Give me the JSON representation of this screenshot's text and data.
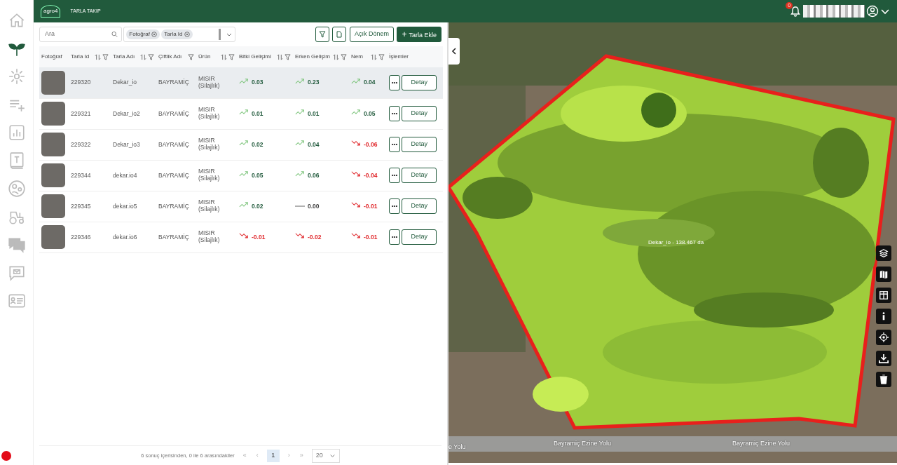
{
  "header": {
    "logo_text": "agro4",
    "app_title": "TARLA TAKIP",
    "notification_count": "0"
  },
  "sidebar": {
    "items": [
      {
        "kind": "home",
        "selected": false
      },
      {
        "kind": "leaf",
        "selected": true
      },
      {
        "kind": "sensor",
        "selected": false
      },
      {
        "kind": "list-add",
        "selected": false
      },
      {
        "kind": "chart",
        "selected": false
      },
      {
        "kind": "book",
        "selected": false
      },
      {
        "kind": "face",
        "selected": false
      },
      {
        "kind": "tractor",
        "selected": false
      },
      {
        "kind": "chat",
        "selected": false
      },
      {
        "kind": "mail",
        "selected": false
      },
      {
        "kind": "card",
        "selected": false
      }
    ]
  },
  "toolbar": {
    "search": {
      "placeholder": "Ara"
    },
    "column_chips": [
      "Fotoğraf",
      "Tarla Id"
    ],
    "open_period_button": "Açık Dönem",
    "add_button": {
      "icon": "+",
      "label": "Tarla Ekle"
    }
  },
  "table": {
    "columns": [
      {
        "label": "Fotoğraf",
        "sortable": false,
        "filterable": false
      },
      {
        "label": "Tarla Id",
        "sortable": true,
        "filterable": true
      },
      {
        "label": "Tarla Adı",
        "sortable": true,
        "filterable": true
      },
      {
        "label": "Çiftlik Adı",
        "sortable": false,
        "filterable": true
      },
      {
        "label": "Ürün",
        "sortable": true,
        "filterable": true
      },
      {
        "label": "Bitki Gelişimi",
        "sortable": true,
        "filterable": true
      },
      {
        "label": "Erken Gelişim",
        "sortable": true,
        "filterable": true
      },
      {
        "label": "Nem",
        "sortable": true,
        "filterable": true
      },
      {
        "label": "İşlemler",
        "sortable": false,
        "filterable": false
      }
    ],
    "rows": [
      {
        "selected": true,
        "id": "229320",
        "name": "Dekar_io",
        "farm": "BAYRAMİÇ",
        "crop": "MISIR",
        "crop_type": "(Silajlık)",
        "metrics": [
          {
            "kind": "up",
            "value": "0.03"
          },
          {
            "kind": "up",
            "value": "0.23"
          },
          {
            "kind": "up",
            "value": "0.04"
          }
        ],
        "more": "•••",
        "detail": "Detay"
      },
      {
        "selected": false,
        "id": "229321",
        "name": "Dekar_io2",
        "farm": "BAYRAMİÇ",
        "crop": "MISIR",
        "crop_type": "(Silajlık)",
        "metrics": [
          {
            "kind": "up",
            "value": "0.01"
          },
          {
            "kind": "up",
            "value": "0.01"
          },
          {
            "kind": "up",
            "value": "0.05"
          }
        ],
        "more": "•••",
        "detail": "Detay"
      },
      {
        "selected": false,
        "id": "229322",
        "name": "Dekar_io3",
        "farm": "BAYRAMİÇ",
        "crop": "MISIR",
        "crop_type": "(Silajlık)",
        "metrics": [
          {
            "kind": "up",
            "value": "0.02"
          },
          {
            "kind": "up",
            "value": "0.04"
          },
          {
            "kind": "down",
            "value": "-0.06"
          }
        ],
        "more": "•••",
        "detail": "Detay"
      },
      {
        "selected": false,
        "id": "229344",
        "name": "dekar.io4",
        "farm": "BAYRAMİÇ",
        "crop": "MISIR",
        "crop_type": "(Silajlık)",
        "metrics": [
          {
            "kind": "up",
            "value": "0.05"
          },
          {
            "kind": "up",
            "value": "0.06"
          },
          {
            "kind": "down",
            "value": "-0.04"
          }
        ],
        "more": "•••",
        "detail": "Detay"
      },
      {
        "selected": false,
        "id": "229345",
        "name": "dekar.io5",
        "farm": "BAYRAMİÇ",
        "crop": "MISIR",
        "crop_type": "(Silajlık)",
        "metrics": [
          {
            "kind": "up",
            "value": "0.02"
          },
          {
            "kind": "flat",
            "value": "0.00"
          },
          {
            "kind": "down",
            "value": "-0.01"
          }
        ],
        "more": "•••",
        "detail": "Detay"
      },
      {
        "selected": false,
        "id": "229346",
        "name": "dekar.io6",
        "farm": "BAYRAMİÇ",
        "crop": "MISIR",
        "crop_type": "(Silajlık)",
        "metrics": [
          {
            "kind": "down",
            "value": "-0.01"
          },
          {
            "kind": "down",
            "value": "-0.02"
          },
          {
            "kind": "down",
            "value": "-0.01"
          }
        ],
        "more": "•••",
        "detail": "Detay"
      }
    ]
  },
  "pagination": {
    "summary": "6 sonuç içerisinden, 0 ile 6 arasındakiler",
    "first": "«",
    "prev": "‹",
    "pages": [
      {
        "label": "1",
        "selected": true
      }
    ],
    "next": "›",
    "last": "»",
    "page_size": "20"
  },
  "map": {
    "field_label": "Dekar_io - 138.467 da",
    "road_labels": [
      "e Yolu",
      "Bayramiç Ezine Yolu",
      "Bayramiç Ezine Yolu"
    ],
    "controls": [
      {
        "kind": "layers"
      },
      {
        "kind": "map"
      },
      {
        "kind": "split"
      },
      {
        "kind": "info"
      },
      {
        "kind": "locate"
      },
      {
        "kind": "download"
      },
      {
        "kind": "delete"
      }
    ]
  }
}
